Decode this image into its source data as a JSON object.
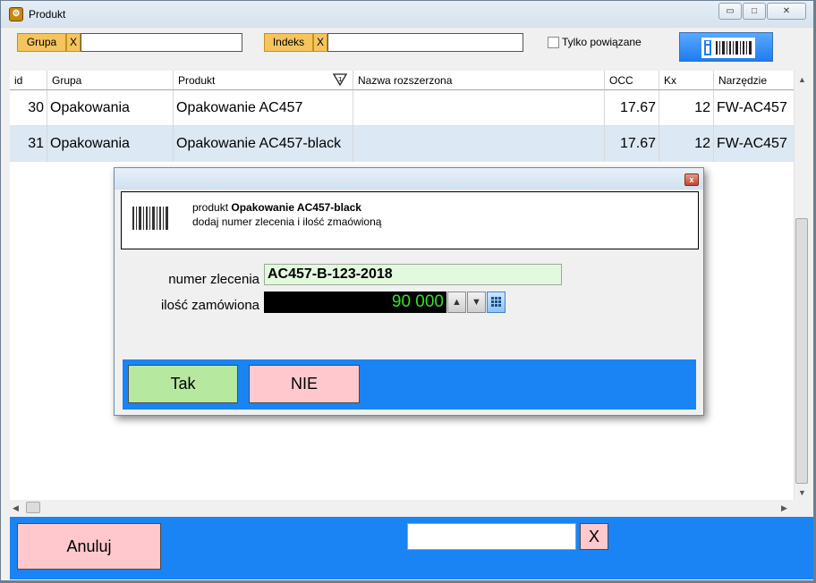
{
  "window": {
    "title": "Produkt",
    "app_icon": "app-icon",
    "controls": {
      "minimize": "▭",
      "maximize": "□",
      "close": "✕"
    }
  },
  "filters": {
    "group_label": "Grupa",
    "group_clear": "X",
    "group_value": "",
    "index_label": "Indeks",
    "index_clear": "X",
    "index_value": "",
    "linked_only_label": "Tylko powiązane",
    "linked_only_checked": false,
    "barcode_button_icon": "barcode-icon"
  },
  "table": {
    "columns": [
      "id",
      "Grupa",
      "Produkt",
      "Nazwa rozszerzona",
      "OCC",
      "Kx",
      "Narzędzie"
    ],
    "sort_column": "Produkt",
    "rows": [
      [
        "30",
        "Opakowania",
        "Opakowanie AC457",
        "",
        "17.67",
        "12",
        "FW-AC457"
      ],
      [
        "31",
        "Opakowania",
        "Opakowanie AC457-black",
        "",
        "17.67",
        "12",
        "FW-AC457"
      ]
    ],
    "selected_row": 1
  },
  "dialog": {
    "close": "x",
    "info_prefix": "produkt ",
    "info_product": "Opakowanie AC457-black",
    "info_line2": "dodaj numer zlecenia i ilość zmaówioną",
    "order_label": "numer zlecenia",
    "order_value": "AC457-B-123-2018",
    "qty_label": "ilość zamówiona",
    "qty_value": "90 000",
    "yes_button": "Tak",
    "no_button": "NIE"
  },
  "bottom": {
    "cancel_button": "Anuluj",
    "search_value": "",
    "clear_button": "X"
  },
  "colors": {
    "accent_blue": "#1a84f5",
    "filter_orange": "#f5c45e",
    "yes_green": "#b6e8a0",
    "no_pink": "#ffc8cc",
    "qty_text": "#35e02a",
    "selected_row": "#dce8f3"
  }
}
